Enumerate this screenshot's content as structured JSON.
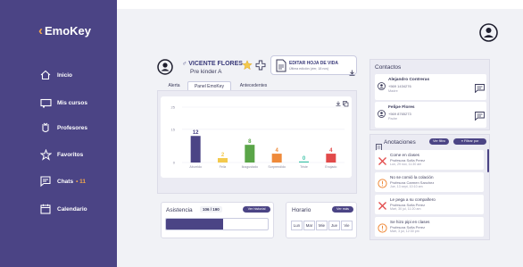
{
  "brand": {
    "name": "EmoKey",
    "chevron": "‹"
  },
  "sidebar": {
    "items": [
      {
        "label": "Inicio",
        "icon": "home-icon"
      },
      {
        "label": "Mis cursos",
        "icon": "board-icon"
      },
      {
        "label": "Profesores",
        "icon": "teacher-icon"
      },
      {
        "label": "Favoritos",
        "icon": "star-icon"
      },
      {
        "label": "Chats",
        "icon": "chat-icon",
        "badge": "• 11"
      },
      {
        "label": "Calendario",
        "icon": "calendar-icon"
      }
    ]
  },
  "student": {
    "name": "VICENTE FLORES",
    "class": "Pre kinder A",
    "gender_symbol": "♂"
  },
  "edit_card": {
    "title": "EDITAR HOJA DE VIDA",
    "subtitle": "Última edición (vier, 18 nov)"
  },
  "tabs": [
    {
      "label": "Alerta",
      "active": false
    },
    {
      "label": "Panel EmoKey",
      "active": true
    },
    {
      "label": "Antecedentes",
      "active": false
    }
  ],
  "chart_data": {
    "type": "bar",
    "categories": [
      "Aburrido",
      "Feliz",
      "Ilusgustado",
      "Sorprendido",
      "Triste",
      "Enojado"
    ],
    "values": [
      12,
      2,
      8,
      4,
      0,
      4
    ],
    "colors": [
      "#4b4485",
      "#f3c94c",
      "#5aa548",
      "#ef8a3a",
      "#3fc3a8",
      "#e24a4a"
    ],
    "yticks": [
      "25",
      "15",
      "0"
    ],
    "ylim": [
      0,
      25
    ]
  },
  "attendance": {
    "title": "Asistencia",
    "value": "106 / 190",
    "button": "Ver historial",
    "progress": 0.558
  },
  "schedule": {
    "title": "Horario",
    "button": "Ver más",
    "days": [
      "Lun",
      "Mar",
      "Mie",
      "Jue",
      "Vie"
    ]
  },
  "contacts": {
    "title": "Contactos",
    "items": [
      {
        "name": "Alejandro Contreras",
        "phone": "+569 1434276",
        "role": "Madre"
      },
      {
        "name": "Felipe Flores",
        "phone": "+569 8765273",
        "role": "Padre"
      }
    ]
  },
  "notes": {
    "title": "Anotaciones",
    "filter_button": "Ver filtro",
    "filter_by": "Filtrar por",
    "items": [
      {
        "title": "Come en clases",
        "teacher": "Profesora Sofia Perez",
        "date": "Lun, 29 nov, 11:30 am",
        "kind": "negative"
      },
      {
        "title": "No se comió la colación",
        "teacher": "Profesora Carmen Sanchez",
        "date": "Jue, 13 sept, 10:10 am",
        "kind": "warning"
      },
      {
        "title": "Le pega a su compañero",
        "teacher": "Profesora Sofia Perez",
        "date": "Mart, 30 jul, 11:20 am",
        "kind": "negative"
      },
      {
        "title": "Se hizo pipi en clases",
        "teacher": "Profesora Sofia Perez",
        "date": "Mart, 3 jul, 12:30 pm",
        "kind": "warning"
      }
    ]
  },
  "colors": {
    "primary": "#4b4485",
    "accent": "#f3a84c",
    "negative": "#e24a4a",
    "warning": "#ef8a3a"
  }
}
